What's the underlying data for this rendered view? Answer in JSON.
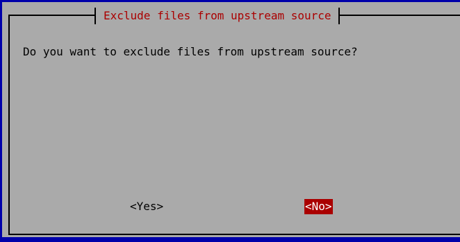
{
  "dialog": {
    "title": "Exclude files from upstream source",
    "prompt": "Do you want to exclude files from upstream source?",
    "buttons": {
      "yes_label": "<Yes>",
      "no_label": "<No>"
    },
    "focused_button": "No"
  },
  "colors": {
    "screen_background": "#0000aa",
    "dialog_background": "#aaaaaa",
    "title_text": "#aa0000",
    "focused_button_background": "#aa0000",
    "focused_button_text": "#ffffff"
  }
}
